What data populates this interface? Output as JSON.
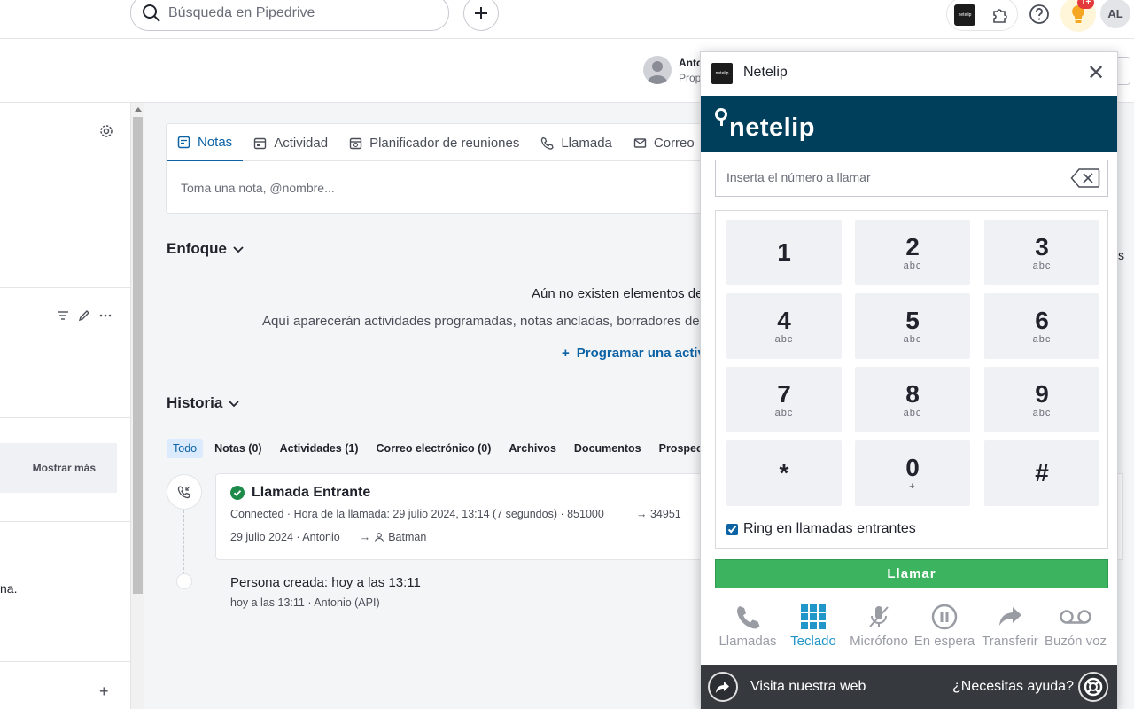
{
  "topbar": {
    "search_placeholder": "Búsqueda en Pipedrive",
    "netelip_ext_label": "netelip",
    "notification_badge": "1+",
    "user_initials": "AL"
  },
  "subbar": {
    "owner_name": "Anto",
    "owner_role": "Prop"
  },
  "left_panel": {
    "show_more": "Mostrar más",
    "truncated_text": "na.",
    "add": "+"
  },
  "composer": {
    "tabs": [
      {
        "label": "Notas",
        "icon": "note-icon"
      },
      {
        "label": "Actividad",
        "icon": "calendar-icon"
      },
      {
        "label": "Planificador de reuniones",
        "icon": "calendar-clock-icon"
      },
      {
        "label": "Llamada",
        "icon": "phone-icon"
      },
      {
        "label": "Correo",
        "icon": "mail-icon"
      }
    ],
    "note_placeholder": "Toma una nota, @nombre..."
  },
  "focus": {
    "title": "Enfoque",
    "empty_title": "Aún no existen elementos de",
    "empty_desc": "Aquí aparecerán actividades programadas, notas ancladas, borradores de",
    "schedule_link": "Programar una activ"
  },
  "history": {
    "title": "Historia",
    "filters": [
      "Todo",
      "Notas (0)",
      "Actividades (1)",
      "Correo electrónico (0)",
      "Archivos",
      "Documentos",
      "Prospect"
    ],
    "call": {
      "title": "Llamada Entrante",
      "meta": "Connected · Hora de la llamada: 29 julio 2024, 13:14 (7 segundos) · 851000",
      "number": "→ 34951",
      "date": "29 julio 2024 · Antonio",
      "contact": "Batman"
    },
    "created": {
      "title": "Persona creada: hoy a las 13:11",
      "meta": "hoy a las 13:11 · Antonio        (API)"
    }
  },
  "right_sliver": "s",
  "netelip": {
    "title": "Netelip",
    "brand": "netelip",
    "logo_text": "netelip",
    "close": "✕",
    "number_placeholder": "Inserta el número a llamar",
    "keys": [
      {
        "digit": "1",
        "letters": ""
      },
      {
        "digit": "2",
        "letters": "abc"
      },
      {
        "digit": "3",
        "letters": "abc"
      },
      {
        "digit": "4",
        "letters": "abc"
      },
      {
        "digit": "5",
        "letters": "abc"
      },
      {
        "digit": "6",
        "letters": "abc"
      },
      {
        "digit": "7",
        "letters": "abc"
      },
      {
        "digit": "8",
        "letters": "abc"
      },
      {
        "digit": "9",
        "letters": "abc"
      },
      {
        "digit": "*",
        "letters": ""
      },
      {
        "digit": "0",
        "letters": "+"
      },
      {
        "digit": "#",
        "letters": ""
      }
    ],
    "ring_label": "Ring en llamadas entrantes",
    "call_button": "Llamar",
    "actions": [
      {
        "label": "Llamadas",
        "icon": "phone-icon"
      },
      {
        "label": "Teclado",
        "icon": "keypad-icon"
      },
      {
        "label": "Micrófono",
        "icon": "mic-off-icon"
      },
      {
        "label": "En espera",
        "icon": "pause-icon"
      },
      {
        "label": "Transferir",
        "icon": "transfer-icon"
      },
      {
        "label": "Buzón voz",
        "icon": "voicemail-icon"
      }
    ],
    "footer_web": "Visita nuestra web",
    "footer_help": "¿Necesitas ayuda?"
  }
}
